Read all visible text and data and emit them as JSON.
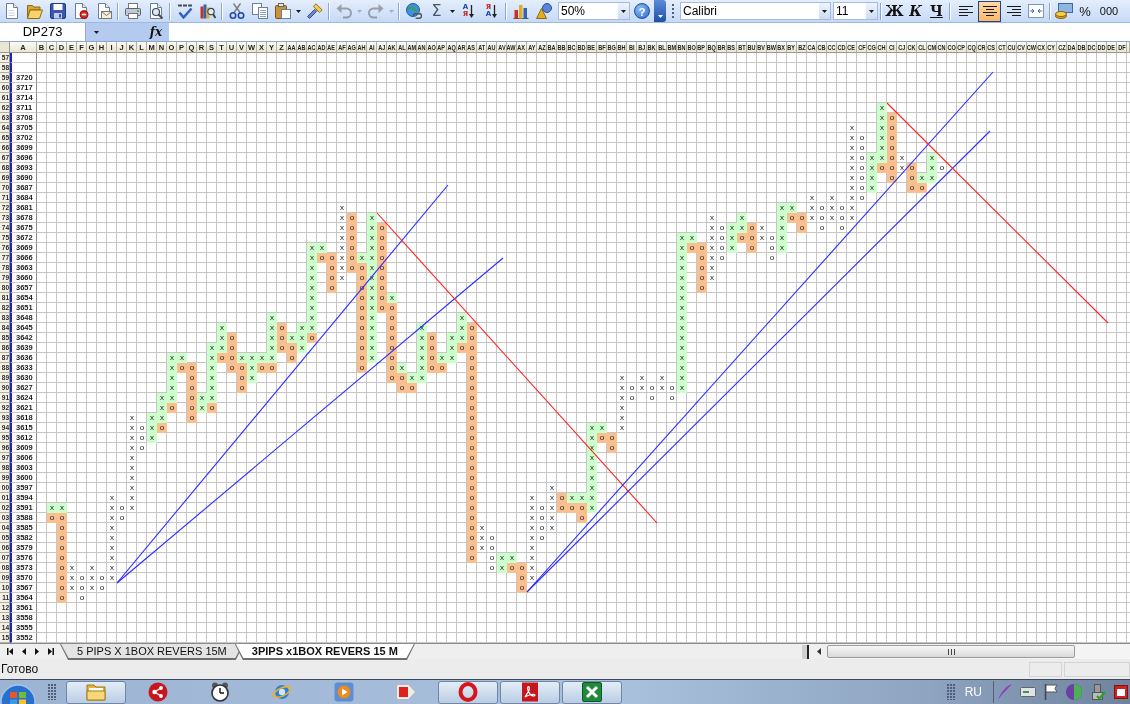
{
  "standard_toolbar": {
    "groups": [
      {
        "buttons": [
          {
            "kind": "new",
            "disabled": false
          },
          {
            "kind": "open",
            "disabled": false
          },
          {
            "kind": "save",
            "disabled": false
          },
          {
            "kind": "permission",
            "disabled": false
          },
          {
            "kind": "email",
            "disabled": false
          }
        ]
      },
      {
        "buttons": [
          {
            "kind": "print",
            "disabled": false
          },
          {
            "kind": "preview",
            "disabled": false
          }
        ]
      },
      {
        "buttons": [
          {
            "kind": "spelling",
            "disabled": false
          },
          {
            "kind": "research",
            "disabled": false
          }
        ]
      },
      {
        "buttons": [
          {
            "kind": "cut",
            "disabled": false
          },
          {
            "kind": "copy",
            "disabled": false
          },
          {
            "kind": "paste",
            "disabled": false
          },
          {
            "kind": "painter",
            "disabled": false
          }
        ]
      },
      {
        "buttons": [
          {
            "kind": "undo",
            "disabled": true
          },
          {
            "kind": "redo",
            "disabled": true
          }
        ]
      },
      {
        "buttons": [
          {
            "kind": "hyperlink",
            "disabled": false
          },
          {
            "kind": "autosum",
            "label": "Σ",
            "disabled": false
          },
          {
            "kind": "sort_ascending",
            "letters": [
              "А",
              "Я"
            ],
            "disabled": false
          },
          {
            "kind": "sort_descending",
            "letters": [
              "Я",
              "А"
            ],
            "disabled": false
          }
        ]
      },
      {
        "buttons": [
          {
            "kind": "chart",
            "disabled": false
          },
          {
            "kind": "drawing",
            "disabled": false
          }
        ]
      }
    ],
    "zoom": "50%",
    "help": "?"
  },
  "formatting_toolbar": {
    "font": "Calibri",
    "font_size": "11",
    "style_buttons": [
      {
        "kind": "bold",
        "label": "Ж"
      },
      {
        "kind": "italic",
        "label": "К"
      },
      {
        "kind": "underline",
        "label": "Ч"
      }
    ],
    "alignment_buttons": [
      {
        "kind": "left",
        "selected": false
      },
      {
        "kind": "center",
        "selected": true
      },
      {
        "kind": "right",
        "selected": false
      }
    ],
    "number_buttons": [
      "%",
      "000"
    ]
  },
  "formula_bar": {
    "name_box": "DP273",
    "function_label": "fx"
  },
  "sheet": {
    "column_headers": [
      "A",
      "B",
      "C",
      "D",
      "E",
      "F",
      "G",
      "H",
      "I",
      "J",
      "K",
      "L",
      "M",
      "N",
      "O",
      "P",
      "Q",
      "R",
      "S",
      "T",
      "U",
      "V",
      "W",
      "X",
      "Y",
      "Z",
      "AA",
      "AB",
      "AC",
      "AD",
      "AE",
      "AF",
      "AG",
      "AH",
      "AI",
      "AJ",
      "AK",
      "AL",
      "AM",
      "AN",
      "AO",
      "AP",
      "AQ",
      "AR",
      "AS",
      "AT",
      "AU",
      "AV",
      "AW",
      "AX",
      "AY",
      "AZ",
      "BA",
      "BB",
      "BC",
      "BD",
      "BE",
      "BF",
      "BG",
      "BH",
      "BI",
      "BJ",
      "BK",
      "BL",
      "BM",
      "BN",
      "BO",
      "BP",
      "BQ",
      "BR",
      "BS",
      "BT",
      "BU",
      "BV",
      "BW",
      "BX",
      "BY",
      "BZ",
      "CA",
      "CB",
      "CC",
      "CD",
      "CE",
      "CF",
      "CG",
      "CH",
      "CI",
      "CJ",
      "CK",
      "CL",
      "CM",
      "CN",
      "CO",
      "CP",
      "CQ",
      "CR",
      "CS",
      "CT",
      "CU",
      "CV",
      "CW",
      "CX",
      "CY",
      "CZ",
      "DA",
      "DB",
      "DC",
      "DD",
      "DE",
      "DF"
    ],
    "rows": [
      {
        "number": "57"
      },
      {
        "number": "58"
      },
      {
        "number": "59",
        "price": "3720"
      },
      {
        "number": "60",
        "price": "3717"
      },
      {
        "number": "61",
        "price": "3714"
      },
      {
        "number": "62",
        "price": "3711",
        "cells": {
          "CH": {
            "text": "x",
            "color": "#ccffcc"
          }
        }
      },
      {
        "number": "63",
        "price": "3708",
        "cells": {
          "CH": {
            "text": "x",
            "color": "#ccffcc"
          },
          "CI": {
            "text": "o",
            "color": "#fabf8f"
          }
        }
      },
      {
        "number": "64",
        "price": "3705",
        "cells": {
          "CE": "x",
          "CH": {
            "text": "x",
            "color": "#ccffcc"
          },
          "CI": {
            "text": "o",
            "color": "#fabf8f"
          }
        }
      },
      {
        "number": "65",
        "price": "3702",
        "cells": {
          "CE": "x",
          "CF": "o",
          "CH": {
            "text": "x",
            "color": "#ccffcc"
          },
          "CI": {
            "text": "o",
            "color": "#fabf8f"
          }
        }
      },
      {
        "number": "66",
        "price": "3699",
        "cells": {
          "CE": "x",
          "CF": "o",
          "CH": {
            "text": "x",
            "color": "#ccffcc"
          },
          "CI": {
            "text": "o",
            "color": "#fabf8f"
          }
        }
      },
      {
        "number": "67",
        "price": "3696",
        "cells": {
          "CE": "x",
          "CF": "o",
          "CG": {
            "text": "x",
            "color": "#ccffcc"
          },
          "CH": {
            "text": "x",
            "color": "#ccffcc"
          },
          "CI": {
            "text": "o",
            "color": "#fabf8f"
          },
          "CJ": "x",
          "CM": {
            "text": "x",
            "color": "#ccffcc"
          }
        }
      },
      {
        "number": "68",
        "price": "3693",
        "cells": {
          "CE": "x",
          "CF": "o",
          "CG": {
            "text": "x",
            "color": "#ccffcc"
          },
          "CH": {
            "text": "o",
            "color": "#fabf8f"
          },
          "CI": {
            "text": "o",
            "color": "#fabf8f"
          },
          "CJ": "x",
          "CK": {
            "text": "o",
            "color": "#fabf8f"
          },
          "CM": {
            "text": "x",
            "color": "#ccffcc"
          },
          "CN": "o"
        }
      },
      {
        "number": "69",
        "price": "3690",
        "cells": {
          "CE": "x",
          "CF": "o",
          "CG": {
            "text": "x",
            "color": "#ccffcc"
          },
          "CI": {
            "text": "o",
            "color": "#fabf8f"
          },
          "CK": {
            "text": "o",
            "color": "#fabf8f"
          },
          "CL": {
            "text": "x",
            "color": "#ccffcc"
          },
          "CM": {
            "text": "x",
            "color": "#ccffcc"
          }
        }
      },
      {
        "number": "70",
        "price": "3687",
        "cells": {
          "CE": "x",
          "CF": "o",
          "CG": {
            "text": "x",
            "color": "#ccffcc"
          },
          "CK": {
            "text": "o",
            "color": "#fabf8f"
          },
          "CL": {
            "text": "o",
            "color": "#fabf8f"
          }
        }
      },
      {
        "number": "71",
        "price": "3684",
        "cells": {
          "CA": "x",
          "CC": "x",
          "CE": "x",
          "CF": "o"
        }
      },
      {
        "number": "72",
        "price": "3681",
        "cells": {
          "AF": "x",
          "BX": {
            "text": "x",
            "color": "#ccffcc"
          },
          "BY": {
            "text": "x",
            "color": "#ccffcc"
          },
          "CA": "x",
          "CB": "o",
          "CC": "x",
          "CD": "o",
          "CE": "x"
        }
      },
      {
        "number": "73",
        "price": "3678",
        "cells": {
          "AF": "x",
          "AG": {
            "text": "o",
            "color": "#fabf8f"
          },
          "AI": {
            "text": "x",
            "color": "#ccffcc"
          },
          "BQ": "x",
          "BT": {
            "text": "x",
            "color": "#ccffcc"
          },
          "BX": {
            "text": "x",
            "color": "#ccffcc"
          },
          "BY": {
            "text": "o",
            "color": "#fabf8f"
          },
          "BZ": {
            "text": "o",
            "color": "#fabf8f"
          },
          "CA": "x",
          "CB": "o",
          "CC": "x",
          "CD": "o",
          "CE": "x"
        }
      },
      {
        "number": "74",
        "price": "3675",
        "cells": {
          "AF": "x",
          "AG": {
            "text": "o",
            "color": "#fabf8f"
          },
          "AI": {
            "text": "x",
            "color": "#ccffcc"
          },
          "AJ": {
            "text": "o",
            "color": "#fabf8f"
          },
          "BQ": "x",
          "BR": "o",
          "BS": {
            "text": "x",
            "color": "#ccffcc"
          },
          "BT": {
            "text": "x",
            "color": "#ccffcc"
          },
          "BU": {
            "text": "o",
            "color": "#fabf8f"
          },
          "BV": "x",
          "BX": {
            "text": "x",
            "color": "#ccffcc"
          },
          "BZ": {
            "text": "o",
            "color": "#fabf8f"
          },
          "CB": "o",
          "CD": "o"
        }
      },
      {
        "number": "75",
        "price": "3672",
        "cells": {
          "AF": "x",
          "AG": {
            "text": "o",
            "color": "#fabf8f"
          },
          "AI": {
            "text": "x",
            "color": "#ccffcc"
          },
          "AJ": {
            "text": "o",
            "color": "#fabf8f"
          },
          "BN": {
            "text": "x",
            "color": "#ccffcc"
          },
          "BO": {
            "text": "x",
            "color": "#ccffcc"
          },
          "BQ": "x",
          "BR": "o",
          "BS": {
            "text": "x",
            "color": "#ccffcc"
          },
          "BT": {
            "text": "o",
            "color": "#fabf8f"
          },
          "BU": {
            "text": "o",
            "color": "#fabf8f"
          },
          "BV": "x",
          "BW": "o",
          "BX": {
            "text": "x",
            "color": "#ccffcc"
          }
        }
      },
      {
        "number": "76",
        "price": "3669",
        "cells": {
          "AC": {
            "text": "x",
            "color": "#ccffcc"
          },
          "AD": {
            "text": "x",
            "color": "#ccffcc"
          },
          "AF": "x",
          "AG": {
            "text": "o",
            "color": "#fabf8f"
          },
          "AI": {
            "text": "x",
            "color": "#ccffcc"
          },
          "AJ": {
            "text": "o",
            "color": "#fabf8f"
          },
          "BN": {
            "text": "x",
            "color": "#ccffcc"
          },
          "BO": {
            "text": "o",
            "color": "#fabf8f"
          },
          "BP": {
            "text": "o",
            "color": "#fabf8f"
          },
          "BQ": "x",
          "BR": "o",
          "BS": {
            "text": "x",
            "color": "#ccffcc"
          },
          "BU": {
            "text": "o",
            "color": "#fabf8f"
          },
          "BW": "o",
          "BX": {
            "text": "x",
            "color": "#ccffcc"
          }
        }
      },
      {
        "number": "77",
        "price": "3666",
        "cells": {
          "AC": {
            "text": "x",
            "color": "#ccffcc"
          },
          "AD": {
            "text": "o",
            "color": "#fabf8f"
          },
          "AE": {
            "text": "o",
            "color": "#fabf8f"
          },
          "AF": "x",
          "AG": {
            "text": "o",
            "color": "#fabf8f"
          },
          "AH": {
            "text": "x",
            "color": "#ccffcc"
          },
          "AI": {
            "text": "x",
            "color": "#ccffcc"
          },
          "AJ": {
            "text": "o",
            "color": "#fabf8f"
          },
          "BN": {
            "text": "x",
            "color": "#ccffcc"
          },
          "BP": {
            "text": "o",
            "color": "#fabf8f"
          },
          "BQ": "x",
          "BR": "o",
          "BW": "o"
        }
      },
      {
        "number": "78",
        "price": "3663",
        "cells": {
          "AC": {
            "text": "x",
            "color": "#ccffcc"
          },
          "AE": {
            "text": "o",
            "color": "#fabf8f"
          },
          "AF": "x",
          "AG": {
            "text": "o",
            "color": "#fabf8f"
          },
          "AH": {
            "text": "o",
            "color": "#fabf8f"
          },
          "AI": {
            "text": "x",
            "color": "#ccffcc"
          },
          "AJ": {
            "text": "o",
            "color": "#fabf8f"
          },
          "BN": {
            "text": "x",
            "color": "#ccffcc"
          },
          "BP": {
            "text": "o",
            "color": "#fabf8f"
          },
          "BQ": "x"
        }
      },
      {
        "number": "79",
        "price": "3660",
        "cells": {
          "AC": {
            "text": "x",
            "color": "#ccffcc"
          },
          "AE": {
            "text": "o",
            "color": "#fabf8f"
          },
          "AF": "x",
          "AH": {
            "text": "o",
            "color": "#fabf8f"
          },
          "AI": {
            "text": "x",
            "color": "#ccffcc"
          },
          "AJ": {
            "text": "o",
            "color": "#fabf8f"
          },
          "BN": {
            "text": "x",
            "color": "#ccffcc"
          },
          "BP": {
            "text": "o",
            "color": "#fabf8f"
          },
          "BQ": "x"
        }
      },
      {
        "number": "80",
        "price": "3657",
        "cells": {
          "AC": {
            "text": "x",
            "color": "#ccffcc"
          },
          "AE": {
            "text": "o",
            "color": "#fabf8f"
          },
          "AH": {
            "text": "o",
            "color": "#fabf8f"
          },
          "AI": {
            "text": "x",
            "color": "#ccffcc"
          },
          "AJ": {
            "text": "o",
            "color": "#fabf8f"
          },
          "BN": {
            "text": "x",
            "color": "#ccffcc"
          },
          "BP": {
            "text": "o",
            "color": "#fabf8f"
          }
        }
      },
      {
        "number": "81",
        "price": "3654",
        "cells": {
          "AC": {
            "text": "x",
            "color": "#ccffcc"
          },
          "AH": {
            "text": "o",
            "color": "#fabf8f"
          },
          "AI": {
            "text": "x",
            "color": "#ccffcc"
          },
          "AJ": {
            "text": "o",
            "color": "#fabf8f"
          },
          "AK": {
            "text": "x",
            "color": "#ccffcc"
          },
          "BN": {
            "text": "x",
            "color": "#ccffcc"
          }
        }
      },
      {
        "number": "82",
        "price": "3651",
        "cells": {
          "AC": {
            "text": "x",
            "color": "#ccffcc"
          },
          "AH": {
            "text": "o",
            "color": "#fabf8f"
          },
          "AI": {
            "text": "x",
            "color": "#ccffcc"
          },
          "AJ": {
            "text": "o",
            "color": "#fabf8f"
          },
          "AK": {
            "text": "o",
            "color": "#fabf8f"
          },
          "BN": {
            "text": "x",
            "color": "#ccffcc"
          }
        }
      },
      {
        "number": "83",
        "price": "3648",
        "cells": {
          "Y": {
            "text": "x",
            "color": "#ccffcc"
          },
          "AC": {
            "text": "x",
            "color": "#ccffcc"
          },
          "AH": {
            "text": "o",
            "color": "#fabf8f"
          },
          "AI": {
            "text": "x",
            "color": "#ccffcc"
          },
          "AK": {
            "text": "o",
            "color": "#fabf8f"
          },
          "AR": {
            "text": "x",
            "color": "#ccffcc"
          },
          "BN": {
            "text": "x",
            "color": "#ccffcc"
          }
        }
      },
      {
        "number": "84",
        "price": "3645",
        "cells": {
          "T": {
            "text": "x",
            "color": "#ccffcc"
          },
          "Y": {
            "text": "x",
            "color": "#ccffcc"
          },
          "Z": {
            "text": "o",
            "color": "#fabf8f"
          },
          "AB": {
            "text": "x",
            "color": "#ccffcc"
          },
          "AC": {
            "text": "x",
            "color": "#ccffcc"
          },
          "AH": {
            "text": "o",
            "color": "#fabf8f"
          },
          "AI": {
            "text": "x",
            "color": "#ccffcc"
          },
          "AK": {
            "text": "o",
            "color": "#fabf8f"
          },
          "AN": {
            "text": "x",
            "color": "#ccffcc"
          },
          "AR": {
            "text": "x",
            "color": "#ccffcc"
          },
          "AS": {
            "text": "o",
            "color": "#fabf8f"
          },
          "BN": {
            "text": "x",
            "color": "#ccffcc"
          }
        }
      },
      {
        "number": "85",
        "price": "3642",
        "cells": {
          "T": {
            "text": "x",
            "color": "#ccffcc"
          },
          "U": {
            "text": "o",
            "color": "#fabf8f"
          },
          "Y": {
            "text": "x",
            "color": "#ccffcc"
          },
          "Z": {
            "text": "o",
            "color": "#fabf8f"
          },
          "AA": {
            "text": "x",
            "color": "#ccffcc"
          },
          "AB": {
            "text": "x",
            "color": "#ccffcc"
          },
          "AC": {
            "text": "o",
            "color": "#fabf8f"
          },
          "AH": {
            "text": "o",
            "color": "#fabf8f"
          },
          "AI": {
            "text": "x",
            "color": "#ccffcc"
          },
          "AK": {
            "text": "o",
            "color": "#fabf8f"
          },
          "AN": {
            "text": "x",
            "color": "#ccffcc"
          },
          "AO": {
            "text": "o",
            "color": "#fabf8f"
          },
          "AQ": {
            "text": "x",
            "color": "#ccffcc"
          },
          "AR": {
            "text": "x",
            "color": "#ccffcc"
          },
          "AS": {
            "text": "o",
            "color": "#fabf8f"
          },
          "BN": {
            "text": "x",
            "color": "#ccffcc"
          }
        }
      },
      {
        "number": "86",
        "price": "3639",
        "cells": {
          "S": {
            "text": "x",
            "color": "#ccffcc"
          },
          "T": {
            "text": "x",
            "color": "#ccffcc"
          },
          "U": {
            "text": "o",
            "color": "#fabf8f"
          },
          "Y": {
            "text": "x",
            "color": "#ccffcc"
          },
          "Z": {
            "text": "o",
            "color": "#fabf8f"
          },
          "AA": {
            "text": "o",
            "color": "#fabf8f"
          },
          "AB": {
            "text": "x",
            "color": "#ccffcc"
          },
          "AH": {
            "text": "o",
            "color": "#fabf8f"
          },
          "AI": {
            "text": "x",
            "color": "#ccffcc"
          },
          "AK": {
            "text": "o",
            "color": "#fabf8f"
          },
          "AN": {
            "text": "x",
            "color": "#ccffcc"
          },
          "AO": {
            "text": "o",
            "color": "#fabf8f"
          },
          "AQ": {
            "text": "x",
            "color": "#ccffcc"
          },
          "AR": {
            "text": "o",
            "color": "#fabf8f"
          },
          "AS": {
            "text": "o",
            "color": "#fabf8f"
          },
          "BN": {
            "text": "x",
            "color": "#ccffcc"
          }
        }
      },
      {
        "number": "87",
        "price": "3636",
        "cells": {
          "O": {
            "text": "x",
            "color": "#ccffcc"
          },
          "P": {
            "text": "x",
            "color": "#ccffcc"
          },
          "S": {
            "text": "x",
            "color": "#ccffcc"
          },
          "T": {
            "text": "o",
            "color": "#fabf8f"
          },
          "U": {
            "text": "o",
            "color": "#fabf8f"
          },
          "V": {
            "text": "x",
            "color": "#ccffcc"
          },
          "W": {
            "text": "x",
            "color": "#ccffcc"
          },
          "X": {
            "text": "x",
            "color": "#ccffcc"
          },
          "Y": {
            "text": "x",
            "color": "#ccffcc"
          },
          "AA": {
            "text": "o",
            "color": "#fabf8f"
          },
          "AH": {
            "text": "o",
            "color": "#fabf8f"
          },
          "AI": {
            "text": "x",
            "color": "#ccffcc"
          },
          "AK": {
            "text": "o",
            "color": "#fabf8f"
          },
          "AN": {
            "text": "x",
            "color": "#ccffcc"
          },
          "AO": {
            "text": "o",
            "color": "#fabf8f"
          },
          "AP": {
            "text": "x",
            "color": "#ccffcc"
          },
          "AQ": {
            "text": "x",
            "color": "#ccffcc"
          },
          "AS": {
            "text": "o",
            "color": "#fabf8f"
          },
          "BN": {
            "text": "x",
            "color": "#ccffcc"
          }
        }
      },
      {
        "number": "88",
        "price": "3633",
        "cells": {
          "O": {
            "text": "x",
            "color": "#ccffcc"
          },
          "P": {
            "text": "o",
            "color": "#fabf8f"
          },
          "Q": {
            "text": "o",
            "color": "#fabf8f"
          },
          "S": {
            "text": "x",
            "color": "#ccffcc"
          },
          "U": {
            "text": "o",
            "color": "#fabf8f"
          },
          "V": {
            "text": "o",
            "color": "#fabf8f"
          },
          "W": {
            "text": "x",
            "color": "#ccffcc"
          },
          "X": {
            "text": "o",
            "color": "#fabf8f"
          },
          "Y": {
            "text": "o",
            "color": "#fabf8f"
          },
          "AH": {
            "text": "o",
            "color": "#fabf8f"
          },
          "AK": {
            "text": "o",
            "color": "#fabf8f"
          },
          "AL": {
            "text": "x",
            "color": "#ccffcc"
          },
          "AN": {
            "text": "x",
            "color": "#ccffcc"
          },
          "AO": {
            "text": "o",
            "color": "#fabf8f"
          },
          "AP": {
            "text": "o",
            "color": "#fabf8f"
          },
          "AS": {
            "text": "o",
            "color": "#fabf8f"
          },
          "BN": {
            "text": "x",
            "color": "#ccffcc"
          }
        }
      },
      {
        "number": "89",
        "price": "3630",
        "cells": {
          "O": {
            "text": "x",
            "color": "#ccffcc"
          },
          "Q": {
            "text": "o",
            "color": "#fabf8f"
          },
          "S": {
            "text": "x",
            "color": "#ccffcc"
          },
          "V": {
            "text": "o",
            "color": "#fabf8f"
          },
          "W": {
            "text": "x",
            "color": "#ccffcc"
          },
          "AK": {
            "text": "o",
            "color": "#fabf8f"
          },
          "AL": {
            "text": "o",
            "color": "#fabf8f"
          },
          "AM": {
            "text": "x",
            "color": "#ccffcc"
          },
          "AN": {
            "text": "x",
            "color": "#ccffcc"
          },
          "AS": {
            "text": "o",
            "color": "#fabf8f"
          },
          "BH": "x",
          "BJ": "x",
          "BL": "x",
          "BN": {
            "text": "x",
            "color": "#ccffcc"
          }
        }
      },
      {
        "number": "90",
        "price": "3627",
        "cells": {
          "O": {
            "text": "x",
            "color": "#ccffcc"
          },
          "Q": {
            "text": "o",
            "color": "#fabf8f"
          },
          "S": {
            "text": "x",
            "color": "#ccffcc"
          },
          "V": {
            "text": "o",
            "color": "#fabf8f"
          },
          "AL": {
            "text": "o",
            "color": "#fabf8f"
          },
          "AM": {
            "text": "o",
            "color": "#fabf8f"
          },
          "AS": {
            "text": "o",
            "color": "#fabf8f"
          },
          "BH": "x",
          "BI": "o",
          "BJ": "x",
          "BK": "o",
          "BL": "x",
          "BM": "o",
          "BN": {
            "text": "x",
            "color": "#ccffcc"
          }
        }
      },
      {
        "number": "91",
        "price": "3624",
        "cells": {
          "N": {
            "text": "x",
            "color": "#ccffcc"
          },
          "O": {
            "text": "x",
            "color": "#ccffcc"
          },
          "Q": {
            "text": "o",
            "color": "#fabf8f"
          },
          "R": {
            "text": "x",
            "color": "#ccffcc"
          },
          "S": {
            "text": "x",
            "color": "#ccffcc"
          },
          "AS": {
            "text": "o",
            "color": "#fabf8f"
          },
          "BH": "x",
          "BI": "o",
          "BK": "o",
          "BM": "o"
        }
      },
      {
        "number": "92",
        "price": "3621",
        "cells": {
          "N": {
            "text": "x",
            "color": "#ccffcc"
          },
          "O": {
            "text": "o",
            "color": "#fabf8f"
          },
          "Q": {
            "text": "o",
            "color": "#fabf8f"
          },
          "R": {
            "text": "x",
            "color": "#ccffcc"
          },
          "S": {
            "text": "o",
            "color": "#fabf8f"
          },
          "AS": {
            "text": "o",
            "color": "#fabf8f"
          },
          "BH": "x"
        }
      },
      {
        "number": "93",
        "price": "3618",
        "cells": {
          "K": "x",
          "M": {
            "text": "x",
            "color": "#ccffcc"
          },
          "N": {
            "text": "x",
            "color": "#ccffcc"
          },
          "Q": {
            "text": "o",
            "color": "#fabf8f"
          },
          "AS": {
            "text": "o",
            "color": "#fabf8f"
          },
          "BH": "x"
        }
      },
      {
        "number": "94",
        "price": "3615",
        "cells": {
          "K": "x",
          "L": "o",
          "M": {
            "text": "x",
            "color": "#ccffcc"
          },
          "N": {
            "text": "o",
            "color": "#fabf8f"
          },
          "AS": {
            "text": "o",
            "color": "#fabf8f"
          },
          "BE": {
            "text": "x",
            "color": "#ccffcc"
          },
          "BF": {
            "text": "x",
            "color": "#ccffcc"
          },
          "BH": "x"
        }
      },
      {
        "number": "95",
        "price": "3612",
        "cells": {
          "K": "x",
          "L": "o",
          "M": {
            "text": "x",
            "color": "#ccffcc"
          },
          "AS": {
            "text": "o",
            "color": "#fabf8f"
          },
          "BE": {
            "text": "x",
            "color": "#ccffcc"
          },
          "BF": {
            "text": "o",
            "color": "#fabf8f"
          },
          "BG": {
            "text": "o",
            "color": "#fabf8f"
          }
        }
      },
      {
        "number": "96",
        "price": "3609",
        "cells": {
          "K": "x",
          "L": "o",
          "AS": {
            "text": "o",
            "color": "#fabf8f"
          },
          "BE": {
            "text": "x",
            "color": "#ccffcc"
          },
          "BG": {
            "text": "o",
            "color": "#fabf8f"
          }
        }
      },
      {
        "number": "97",
        "price": "3606",
        "cells": {
          "K": "x",
          "AS": {
            "text": "o",
            "color": "#fabf8f"
          },
          "BE": {
            "text": "x",
            "color": "#ccffcc"
          }
        }
      },
      {
        "number": "98",
        "price": "3603",
        "cells": {
          "K": "x",
          "AS": {
            "text": "o",
            "color": "#fabf8f"
          },
          "BE": {
            "text": "x",
            "color": "#ccffcc"
          }
        }
      },
      {
        "number": "99",
        "price": "3600",
        "cells": {
          "K": "x",
          "AS": {
            "text": "o",
            "color": "#fabf8f"
          },
          "BE": {
            "text": "x",
            "color": "#ccffcc"
          }
        }
      },
      {
        "number": "00",
        "price": "3597",
        "cells": {
          "K": "x",
          "AS": {
            "text": "o",
            "color": "#fabf8f"
          },
          "BA": "x",
          "BE": {
            "text": "x",
            "color": "#ccffcc"
          }
        }
      },
      {
        "number": "01",
        "price": "3594",
        "cells": {
          "I": "x",
          "K": "x",
          "AS": {
            "text": "o",
            "color": "#fabf8f"
          },
          "AY": "x",
          "BA": "x",
          "BB": {
            "text": "o",
            "color": "#fabf8f"
          },
          "BC": {
            "text": "x",
            "color": "#ccffcc"
          },
          "BD": {
            "text": "x",
            "color": "#ccffcc"
          },
          "BE": {
            "text": "x",
            "color": "#ccffcc"
          }
        }
      },
      {
        "number": "02",
        "price": "3591",
        "cells": {
          "C": {
            "text": "x",
            "color": "#ccffcc"
          },
          "D": {
            "text": "x",
            "color": "#ccffcc"
          },
          "I": "x",
          "J": "o",
          "K": "x",
          "AS": {
            "text": "o",
            "color": "#fabf8f"
          },
          "AY": "x",
          "AZ": "o",
          "BA": "x",
          "BB": {
            "text": "o",
            "color": "#fabf8f"
          },
          "BC": {
            "text": "o",
            "color": "#fabf8f"
          },
          "BD": {
            "text": "o",
            "color": "#fabf8f"
          },
          "BE": {
            "text": "x",
            "color": "#ccffcc"
          }
        }
      },
      {
        "number": "03",
        "price": "3588",
        "cells": {
          "C": {
            "text": "o",
            "color": "#fabf8f"
          },
          "D": {
            "text": "o",
            "color": "#fabf8f"
          },
          "I": "x",
          "J": "o",
          "AS": {
            "text": "o",
            "color": "#fabf8f"
          },
          "AY": "x",
          "AZ": "o",
          "BA": "x",
          "BD": {
            "text": "o",
            "color": "#fabf8f"
          }
        }
      },
      {
        "number": "04",
        "price": "3585",
        "cells": {
          "D": {
            "text": "o",
            "color": "#fabf8f"
          },
          "I": "x",
          "AS": {
            "text": "o",
            "color": "#fabf8f"
          },
          "AT": "x",
          "AY": "x",
          "AZ": "o",
          "BA": "x"
        }
      },
      {
        "number": "05",
        "price": "3582",
        "cells": {
          "D": {
            "text": "o",
            "color": "#fabf8f"
          },
          "I": "x",
          "AS": {
            "text": "o",
            "color": "#fabf8f"
          },
          "AT": "x",
          "AU": "o",
          "AY": "x",
          "AZ": "o"
        }
      },
      {
        "number": "06",
        "price": "3579",
        "cells": {
          "D": {
            "text": "o",
            "color": "#fabf8f"
          },
          "I": "x",
          "AS": {
            "text": "o",
            "color": "#fabf8f"
          },
          "AT": "x",
          "AU": "o",
          "AY": "x"
        }
      },
      {
        "number": "07",
        "price": "3576",
        "cells": {
          "D": {
            "text": "o",
            "color": "#fabf8f"
          },
          "I": "x",
          "AS": {
            "text": "o",
            "color": "#fabf8f"
          },
          "AU": "o",
          "AV": {
            "text": "x",
            "color": "#ccffcc"
          },
          "AW": {
            "text": "x",
            "color": "#ccffcc"
          },
          "AY": "x"
        }
      },
      {
        "number": "08",
        "price": "3573",
        "cells": {
          "D": {
            "text": "o",
            "color": "#fabf8f"
          },
          "E": "x",
          "G": "x",
          "I": "x",
          "AU": "o",
          "AV": {
            "text": "x",
            "color": "#ccffcc"
          },
          "AW": {
            "text": "o",
            "color": "#fabf8f"
          },
          "AX": {
            "text": "o",
            "color": "#fabf8f"
          },
          "AY": "x"
        }
      },
      {
        "number": "09",
        "price": "3570",
        "cells": {
          "D": {
            "text": "o",
            "color": "#fabf8f"
          },
          "E": "x",
          "F": "o",
          "G": "x",
          "H": "o",
          "I": "x",
          "AX": {
            "text": "o",
            "color": "#fabf8f"
          },
          "AY": "x"
        }
      },
      {
        "number": "10",
        "price": "3567",
        "cells": {
          "D": {
            "text": "o",
            "color": "#fabf8f"
          },
          "E": "x",
          "F": "o",
          "G": "x",
          "H": "o",
          "AX": {
            "text": "o",
            "color": "#fabf8f"
          }
        }
      },
      {
        "number": "11",
        "price": "3564",
        "cells": {
          "D": {
            "text": "o",
            "color": "#fabf8f"
          },
          "F": "o"
        }
      },
      {
        "number": "12",
        "price": "3561"
      },
      {
        "number": "13",
        "price": "3558"
      },
      {
        "number": "14",
        "price": "3555"
      },
      {
        "number": "15",
        "price": "3552"
      }
    ],
    "trend_lines": [
      {
        "color": "#2b2bff"
      },
      {
        "color": "#2b2bff"
      },
      {
        "color": "#ff2020"
      },
      {
        "color": "#2b2bff"
      },
      {
        "color": "#2b2bff"
      },
      {
        "color": "#ff2020"
      }
    ]
  },
  "sheet_tabs": [
    {
      "label": "5 PIPS X 1BOX REVERS 15M",
      "selected": false
    },
    {
      "label": "3PIPS x1BOX REVERS 15 M",
      "selected": true
    }
  ],
  "status_bar": {
    "text": "Готово"
  },
  "taskbar": {
    "buttons": [
      {
        "kind": "folder",
        "open": true
      },
      {
        "kind": "share",
        "open": false
      },
      {
        "kind": "clock",
        "open": false
      },
      {
        "kind": "browser",
        "open": false
      },
      {
        "kind": "media",
        "open": false
      },
      {
        "kind": "tag",
        "open": false
      },
      {
        "kind": "ring",
        "open": true
      },
      {
        "kind": "pdf",
        "open": true
      },
      {
        "kind": "spreadsheet",
        "open": true
      }
    ],
    "language": "RU"
  }
}
